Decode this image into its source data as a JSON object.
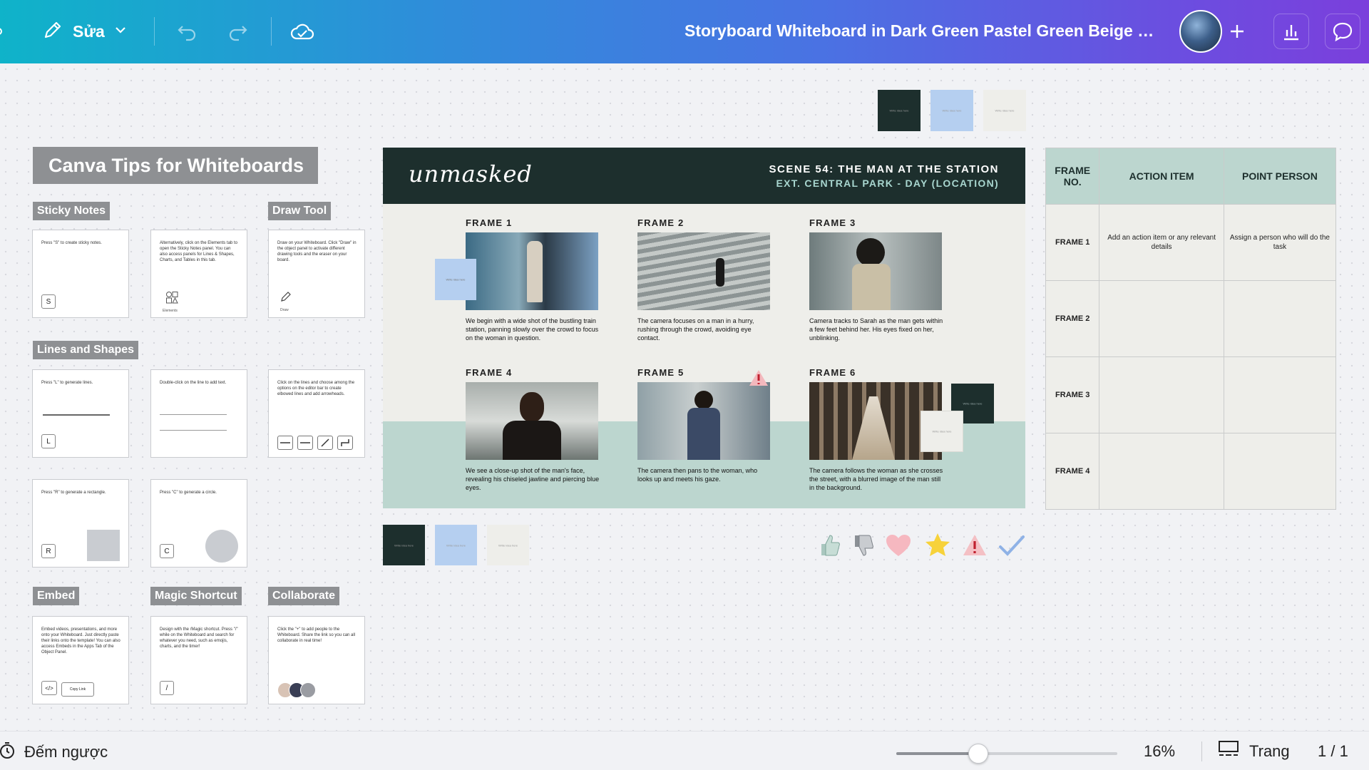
{
  "toolbar": {
    "edit_label": "Sửa",
    "doc_title": "Storyboard Whiteboard in Dark Green Pastel Green Beige S...",
    "icons": [
      "pencil-icon",
      "chevron-down-icon",
      "undo-icon",
      "redo-icon",
      "cloud-check-icon",
      "plus-icon",
      "bar-chart-icon",
      "comment-icon"
    ]
  },
  "tips": {
    "title": "Canva Tips for Whiteboards",
    "sections": {
      "sticky": "Sticky Notes",
      "draw": "Draw Tool",
      "lines": "Lines and Shapes",
      "embed": "Embed",
      "magic": "Magic Shortcut",
      "collab": "Collaborate"
    },
    "cards": {
      "sticky1": "Press \"S\" to create sticky notes.",
      "sticky2": "Alternatively, click on the Elements tab to open the Sticky Notes panel. You can also access panels for Lines & Shapes, Charts, and Tables in this tab.",
      "draw": "Draw on your Whiteboard. Click \"Draw\" in the object panel to activate different drawing tools and the eraser on your board.",
      "line1": "Press \"L\" to generate lines.",
      "line2": "Double-click on the line to add text.",
      "line3": "Click on the lines and choose among the options on the editor bar to create elbowed lines and add arrowheads.",
      "rect": "Press \"R\" to generate a rectangle.",
      "circle": "Press \"C\" to generate a circle.",
      "embed": "Embed videos, presentations, and more onto your Whiteboard. Just directly paste their links onto the template! You can also access Embeds in the Apps Tab of the Object Panel.",
      "magic": "Design with the /Magic shortcut. Press \"/\" while on the Whiteboard and search for whatever you need, such as emojis, charts, and the timer!",
      "collab": "Click the \"+\" to add people to the Whiteboard. Share the link so you can all collaborate in real time!",
      "elements_label": "Elements",
      "draw_label": "Draw",
      "copy_link": "Copy Link"
    },
    "keys": {
      "s": "S",
      "l": "L",
      "r": "R",
      "c": "C",
      "embed": "</>",
      "slash": "/"
    }
  },
  "storyboard": {
    "logo": "unmasked",
    "scene_title": "SCENE 54: THE MAN AT THE STATION",
    "scene_sub": "EXT. CENTRAL PARK - DAY (LOCATION)",
    "frames": [
      {
        "label": "FRAME 1",
        "caption": "We begin with a wide shot of the bustling train station, panning slowly over the crowd to focus on the woman in question."
      },
      {
        "label": "FRAME 2",
        "caption": "The camera focuses on a man in a hurry, rushing through the crowd, avoiding eye contact."
      },
      {
        "label": "FRAME 3",
        "caption": "Camera tracks to Sarah as the man gets within a few feet behind her. His eyes fixed on her, unblinking."
      },
      {
        "label": "FRAME 4",
        "caption": "We see a close-up shot of the man's face, revealing his chiseled jawline and piercing blue eyes."
      },
      {
        "label": "FRAME 5",
        "caption": "The camera then pans to the woman, who looks up and meets his gaze."
      },
      {
        "label": "FRAME 6",
        "caption": "The camera follows the woman as she crosses the street, with a blurred image of the man still in the background."
      }
    ],
    "sticky_text": "Write idea here",
    "colors": {
      "dark": "#1d2f2d",
      "mint": "#bcd6cf",
      "beige": "#eeeeea",
      "blue": "#b5cff0"
    }
  },
  "table": {
    "headers": [
      "FRAME NO.",
      "ACTION ITEM",
      "POINT PERSON"
    ],
    "rows": [
      [
        "FRAME 1",
        "Add an action item or any relevant details",
        "Assign a person who will do the task"
      ],
      [
        "FRAME 2",
        "",
        ""
      ],
      [
        "FRAME 3",
        "",
        ""
      ],
      [
        "FRAME 4",
        "",
        ""
      ]
    ]
  },
  "reactions": [
    "thumbs-up-icon",
    "thumbs-down-icon",
    "heart-icon",
    "star-icon",
    "warning-icon",
    "check-icon"
  ],
  "bottombar": {
    "timer_label": "Đếm ngược",
    "zoom": "16%",
    "zoom_fraction": 0.37,
    "pages_label": "Trang",
    "page_count": "1 / 1"
  }
}
